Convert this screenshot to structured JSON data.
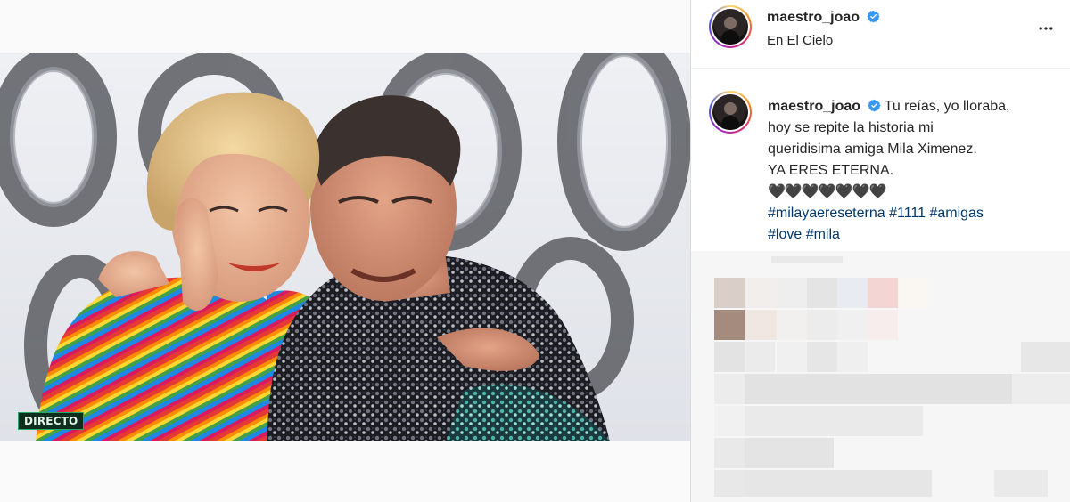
{
  "post": {
    "author": {
      "username": "maestro_joao",
      "verified": true,
      "location": "En El Cielo"
    },
    "caption": {
      "username": "maestro_joao",
      "lines": [
        "Tu reías, yo lloraba,",
        "hoy se repite la historia mi",
        "queridisima amiga Mila Ximenez.",
        "YA ERES ETERNA."
      ],
      "hearts": "🖤🖤🖤🖤🖤🖤🖤",
      "hashtags_line1": [
        "#milayaereseterna",
        "#1111",
        "#amigas"
      ],
      "hashtags_line2": [
        "#love",
        "#mila"
      ]
    },
    "media": {
      "tv_badge": "DIRECTO"
    }
  },
  "icons": {
    "verified": "verified-badge-icon",
    "more": "more-options-icon"
  },
  "colors": {
    "link": "#00376b",
    "verified": "#3897f0",
    "text": "#262626",
    "badge_green": "#2aa866"
  }
}
